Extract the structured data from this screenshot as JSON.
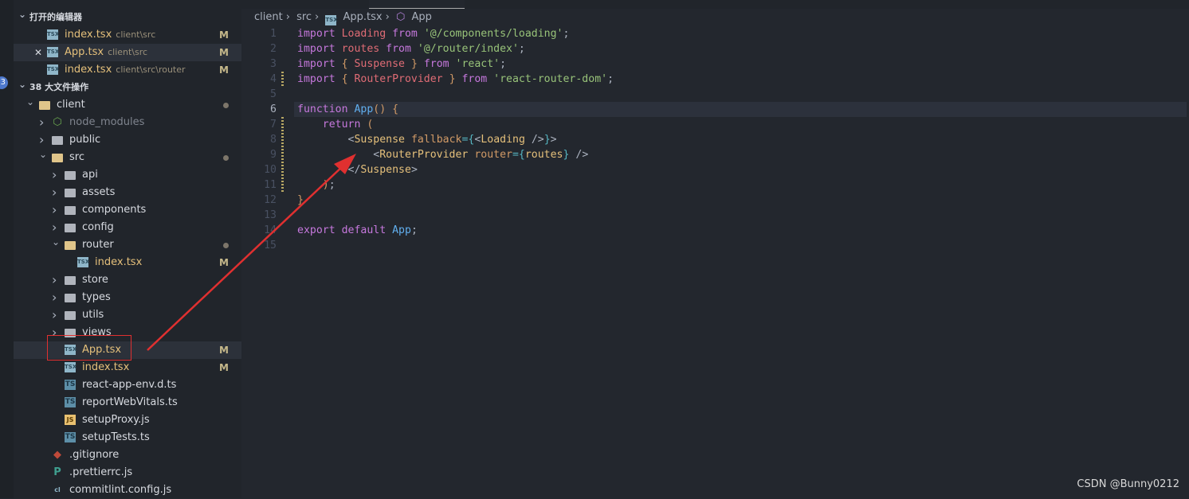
{
  "activity_bar": {
    "badge": "3"
  },
  "sidebar": {
    "open_editors_title": "打开的编辑器",
    "open_editors": [
      {
        "name": "index.tsx",
        "path": "client\\src",
        "status": "M",
        "icon": "tsx"
      },
      {
        "name": "App.tsx",
        "path": "client\\src",
        "status": "M",
        "icon": "tsx",
        "selected": true,
        "close": "✕"
      },
      {
        "name": "index.tsx",
        "path": "client\\src\\router",
        "status": "M",
        "icon": "tsx"
      }
    ],
    "workspace_title": "38 大文件操作",
    "tree": [
      {
        "name": "client",
        "type": "folder",
        "open": true,
        "depth": 0,
        "dot": true
      },
      {
        "name": "node_modules",
        "type": "node",
        "depth": 1
      },
      {
        "name": "public",
        "type": "folder",
        "depth": 1
      },
      {
        "name": "src",
        "type": "folder",
        "open": true,
        "depth": 1,
        "dot": true
      },
      {
        "name": "api",
        "type": "folder",
        "depth": 2
      },
      {
        "name": "assets",
        "type": "folder",
        "depth": 2
      },
      {
        "name": "components",
        "type": "folder",
        "depth": 2
      },
      {
        "name": "config",
        "type": "folder",
        "depth": 2
      },
      {
        "name": "router",
        "type": "folder",
        "open": true,
        "depth": 2,
        "dot": true
      },
      {
        "name": "index.tsx",
        "type": "tsx",
        "depth": 3,
        "status": "M"
      },
      {
        "name": "store",
        "type": "folder",
        "depth": 2
      },
      {
        "name": "types",
        "type": "folder",
        "depth": 2
      },
      {
        "name": "utils",
        "type": "folder",
        "depth": 2
      },
      {
        "name": "views",
        "type": "folder",
        "depth": 2
      },
      {
        "name": "App.tsx",
        "type": "tsx",
        "depth": 2,
        "status": "M",
        "selected": true
      },
      {
        "name": "index.tsx",
        "type": "tsx",
        "depth": 2,
        "status": "M"
      },
      {
        "name": "react-app-env.d.ts",
        "type": "ts",
        "depth": 2
      },
      {
        "name": "reportWebVitals.ts",
        "type": "ts",
        "depth": 2
      },
      {
        "name": "setupProxy.js",
        "type": "js",
        "depth": 2
      },
      {
        "name": "setupTests.ts",
        "type": "ts",
        "depth": 2
      },
      {
        "name": ".gitignore",
        "type": "git",
        "depth": 1
      },
      {
        "name": ".prettierrc.js",
        "type": "prettier",
        "depth": 1
      },
      {
        "name": "commitlint.config.js",
        "type": "config",
        "depth": 1
      }
    ]
  },
  "breadcrumb": [
    "client",
    "src",
    "App.tsx",
    "App"
  ],
  "code": {
    "current_line": 6,
    "lines": [
      [
        [
          "import",
          "kw"
        ],
        [
          " Loading ",
          "id"
        ],
        [
          "from",
          "kw"
        ],
        [
          " '@/components/loading'",
          "str"
        ],
        [
          ";",
          "pun"
        ]
      ],
      [
        [
          "import",
          "kw"
        ],
        [
          " routes ",
          "id"
        ],
        [
          "from",
          "kw"
        ],
        [
          " '@/router/index'",
          "str"
        ],
        [
          ";",
          "pun"
        ]
      ],
      [
        [
          "import",
          "kw"
        ],
        [
          " { ",
          "br"
        ],
        [
          "Suspense",
          "id"
        ],
        [
          " } ",
          "br"
        ],
        [
          "from",
          "kw"
        ],
        [
          " 'react'",
          "str"
        ],
        [
          ";",
          "pun"
        ]
      ],
      [
        [
          "import",
          "kw"
        ],
        [
          " { ",
          "br"
        ],
        [
          "RouterProvider",
          "id"
        ],
        [
          " } ",
          "br"
        ],
        [
          "from",
          "kw"
        ],
        [
          " 'react-router-dom'",
          "str"
        ],
        [
          ";",
          "pun"
        ]
      ],
      [],
      [
        [
          "function",
          "kw"
        ],
        [
          " App",
          "fn"
        ],
        [
          "()",
          "br"
        ],
        [
          " {",
          "br"
        ]
      ],
      [
        [
          "    return",
          "kw"
        ],
        [
          " (",
          "br"
        ]
      ],
      [
        [
          "        <",
          "pun"
        ],
        [
          "Suspense",
          "tag"
        ],
        [
          " fallback",
          "attr"
        ],
        [
          "={",
          "cy"
        ],
        [
          "<",
          "pun"
        ],
        [
          "Loading",
          "tag"
        ],
        [
          " />",
          "pun"
        ],
        [
          "}",
          "cy"
        ],
        [
          ">",
          "pun"
        ]
      ],
      [
        [
          "            <",
          "pun"
        ],
        [
          "RouterProvider",
          "tag"
        ],
        [
          " router",
          "attr"
        ],
        [
          "={",
          "cy"
        ],
        [
          "routes",
          "tag"
        ],
        [
          "}",
          "cy"
        ],
        [
          " />",
          "pun"
        ]
      ],
      [
        [
          "        </",
          "pun"
        ],
        [
          "Suspense",
          "tag"
        ],
        [
          ">",
          "pun"
        ]
      ],
      [
        [
          "    )",
          "br"
        ],
        [
          ";",
          "pun"
        ]
      ],
      [
        [
          "}",
          "br"
        ]
      ],
      [],
      [
        [
          "export",
          "kw"
        ],
        [
          " default",
          "kw"
        ],
        [
          " App",
          "fn"
        ],
        [
          ";",
          "pun"
        ]
      ],
      []
    ]
  },
  "watermark": "CSDN @Bunny0212",
  "colors": {
    "annotation": "#e03030",
    "accent": "#4d78cc"
  }
}
